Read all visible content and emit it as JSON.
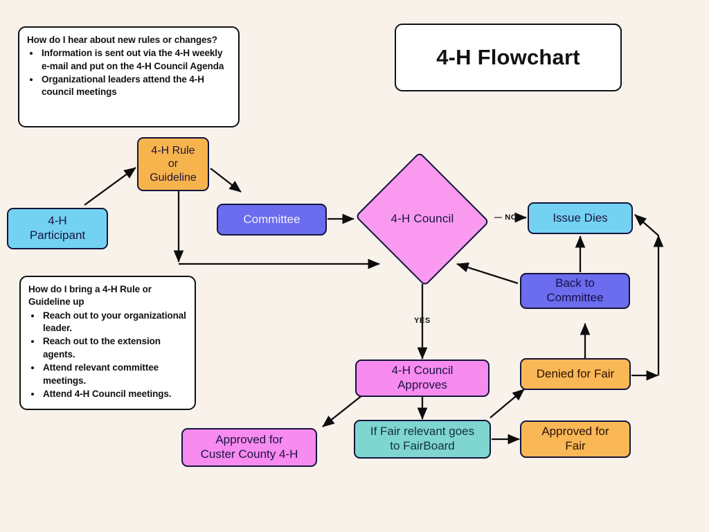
{
  "page": {
    "background_color": "#f8f2eb",
    "title": "4-H Flowchart"
  },
  "title_card": {
    "label": "4-H Flowchart"
  },
  "notes": [
    {
      "heading": "How do I hear about new rules or changes?",
      "bullets": [
        "Information is sent out via the 4-H weekly e-mail and put on the 4-H Council Agenda",
        "Organizational leaders attend the 4-H council meetings"
      ]
    },
    {
      "heading": "How do I bring a 4-H Rule or Guideline up",
      "bullets": [
        "Reach out to your organizational leader.",
        "Reach out to the extension agents.",
        "Attend relevant committee meetings.",
        "Attend 4-H Council meetings."
      ]
    }
  ],
  "nodes": {
    "participant": {
      "label": "4-H\nParticipant",
      "color": "#73d2f2",
      "text_color": "#1b1340"
    },
    "rule": {
      "label": "4-H Rule\nor\nGuideline",
      "color": "#f8b44c",
      "text_color": "#1b1340"
    },
    "committee": {
      "label": "Committee",
      "color": "#6c6cee",
      "text_color": "#eef0ff"
    },
    "council": {
      "label": "4-H Council",
      "color": "#f99af0",
      "text_color": "#3d1240"
    },
    "issue_dies": {
      "label": "Issue Dies",
      "color": "#73d2f2",
      "text_color": "#1b1340"
    },
    "back_to_committee": {
      "label": "Back to\nCommittee",
      "color": "#6c6cee",
      "text_color": "#141046"
    },
    "council_approves": {
      "label": "4-H Council\nApproves",
      "color": "#f78bf0",
      "text_color": "#3d1240"
    },
    "denied_for_fair": {
      "label": "Denied for Fair",
      "color": "#f9b756",
      "text_color": "#2a1205"
    },
    "fairboard": {
      "label": "If Fair relevant goes\nto FairBoard",
      "color": "#7fd5d0",
      "text_color": "#10313a"
    },
    "approved_custer": {
      "label": "Approved for\nCuster County 4-H",
      "color": "#f78bf0",
      "text_color": "#3d1240"
    },
    "approved_fair": {
      "label": "Approved for\nFair",
      "color": "#f9b756",
      "text_color": "#2a1205"
    }
  },
  "edge_labels": {
    "no": "— NO →",
    "yes": "YES"
  }
}
